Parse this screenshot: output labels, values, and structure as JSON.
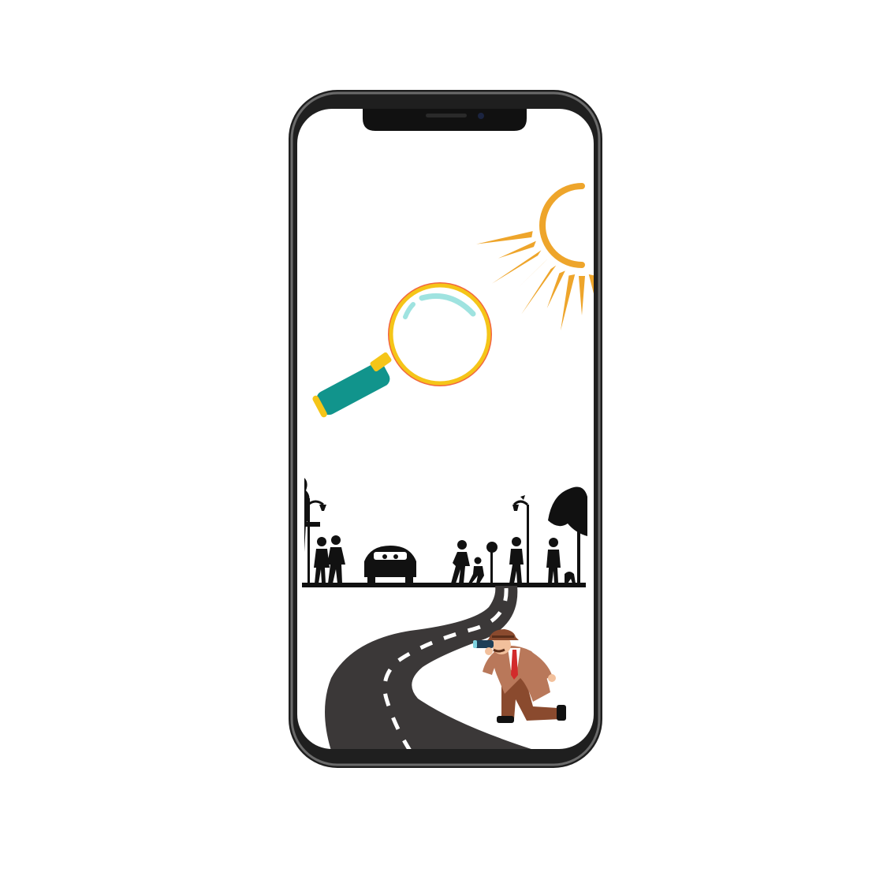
{
  "colors": {
    "background": "#ffffff",
    "phone_frame": "#1f1f1f",
    "phone_frame_highlight": "#6b6b6b",
    "screen": "#ffffff",
    "sun": "#eea52b",
    "magnifier_ring": "#f26540",
    "magnifier_inner_ring": "#f5c518",
    "magnifier_glint": "#9fe3e0",
    "magnifier_handle": "#11948c",
    "silhouette": "#111111",
    "road": "#3b3838",
    "road_marking": "#ffffff",
    "detective_coat": "#b9785a",
    "detective_pants": "#8a4a2e",
    "detective_skin": "#f2c09c",
    "detective_tie": "#d22b2b"
  },
  "icons": {
    "phone": "smartphone-frame",
    "sun": "sun-icon",
    "magnifier": "magnifying-glass-icon",
    "street": "street-silhouette",
    "road": "winding-road",
    "detective": "detective-with-binoculars"
  }
}
